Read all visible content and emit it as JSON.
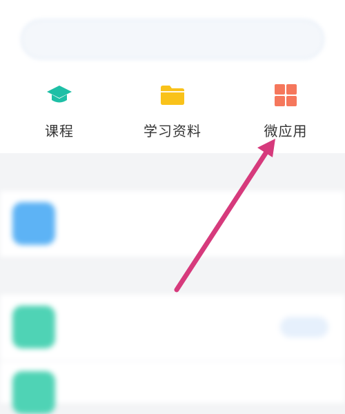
{
  "search": {
    "placeholder": ""
  },
  "quick_entries": [
    {
      "label": "课程",
      "icon": "graduation-cap-icon",
      "color": "#1ebfa6"
    },
    {
      "label": "学习资料",
      "icon": "folder-icon",
      "color": "#f9c21a"
    },
    {
      "label": "微应用",
      "icon": "grid-apps-icon",
      "color": "#f5775c"
    }
  ],
  "sections": [
    {
      "title": ""
    },
    {
      "title": ""
    }
  ],
  "apps": [
    {
      "name": "",
      "icon": "app-icon",
      "color": "#5db3f5"
    },
    {
      "name": "",
      "icon": "app-icon",
      "color": "#4fd3b5",
      "action": ""
    },
    {
      "name": "",
      "icon": "app-icon",
      "color": "#4fd3b5"
    }
  ],
  "annotation": {
    "type": "arrow",
    "color": "#d63a7c"
  }
}
